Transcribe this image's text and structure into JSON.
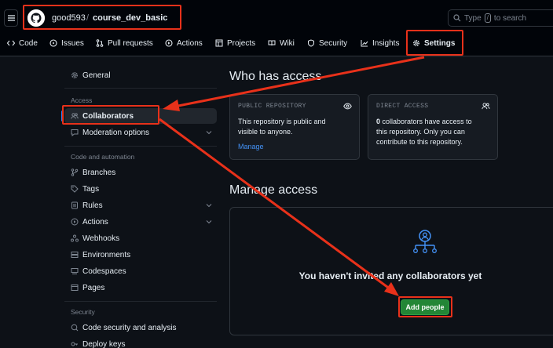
{
  "header": {
    "owner": "good593",
    "separator": "/",
    "repo": "course_dev_basic",
    "search_prefix": "Type",
    "search_key": "/",
    "search_suffix": "to search"
  },
  "tabs": [
    {
      "label": "Code",
      "icon": "code-icon"
    },
    {
      "label": "Issues",
      "icon": "issue-icon"
    },
    {
      "label": "Pull requests",
      "icon": "pull-request-icon"
    },
    {
      "label": "Actions",
      "icon": "play-icon"
    },
    {
      "label": "Projects",
      "icon": "table-icon"
    },
    {
      "label": "Wiki",
      "icon": "book-icon"
    },
    {
      "label": "Security",
      "icon": "shield-icon"
    },
    {
      "label": "Insights",
      "icon": "graph-icon"
    },
    {
      "label": "Settings",
      "icon": "gear-icon",
      "active": true
    }
  ],
  "sidebar": {
    "general": "General",
    "section_access": "Access",
    "collaborators": "Collaborators",
    "moderation": "Moderation options",
    "section_code": "Code and automation",
    "branches": "Branches",
    "tags": "Tags",
    "rules": "Rules",
    "actions": "Actions",
    "webhooks": "Webhooks",
    "environments": "Environments",
    "codespaces": "Codespaces",
    "pages": "Pages",
    "section_security": "Security",
    "code_security": "Code security and analysis",
    "deploy_keys": "Deploy keys"
  },
  "main": {
    "who_title": "Who has access",
    "public_card": {
      "title": "PUBLIC REPOSITORY",
      "line1": "This repository is public and",
      "line2": "visible to anyone.",
      "link": "Manage"
    },
    "direct_card": {
      "title": "DIRECT ACCESS",
      "count": "0",
      "line1": "collaborators have access to",
      "line2": "this repository. Only you can",
      "line3": "contribute to this repository."
    },
    "manage_title": "Manage access",
    "empty_title": "You haven't invited any collaborators yet",
    "add_button": "Add people"
  },
  "colors": {
    "annotation_red": "#e8311a",
    "button_green": "#238636",
    "link_blue": "#4493f8"
  }
}
